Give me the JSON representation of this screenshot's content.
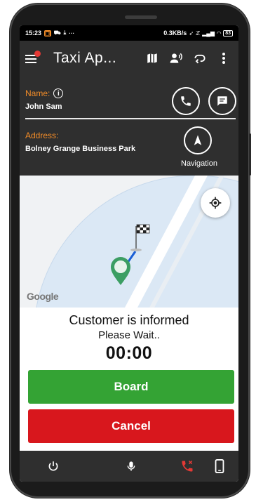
{
  "status_bar": {
    "time": "15:23",
    "network_speed": "0.3KB/s",
    "battery": "83"
  },
  "app_bar": {
    "title": "Taxi Ap...",
    "actions": [
      "map-icon",
      "voice-icon",
      "route-icon",
      "more-vert-icon"
    ]
  },
  "customer": {
    "name_label": "Name:",
    "name": "John Sam",
    "address_label": "Address:",
    "address": "Bolney Grange Business Park",
    "navigation_label": "Navigation"
  },
  "map": {
    "attribution": "Google"
  },
  "trip_status": {
    "title": "Customer is informed",
    "subtitle": "Please Wait..",
    "timer": "00:00"
  },
  "actions": {
    "board_label": "Board",
    "cancel_label": "Cancel"
  },
  "bottom_bar": {
    "icons": [
      "power-icon",
      "mic-icon",
      "call-end-icon",
      "phone-device-icon"
    ]
  },
  "colors": {
    "accent_orange": "#f28c28",
    "board_green": "#34a334",
    "cancel_red": "#d8171d",
    "toolbar_dark": "#2f2f2f"
  }
}
